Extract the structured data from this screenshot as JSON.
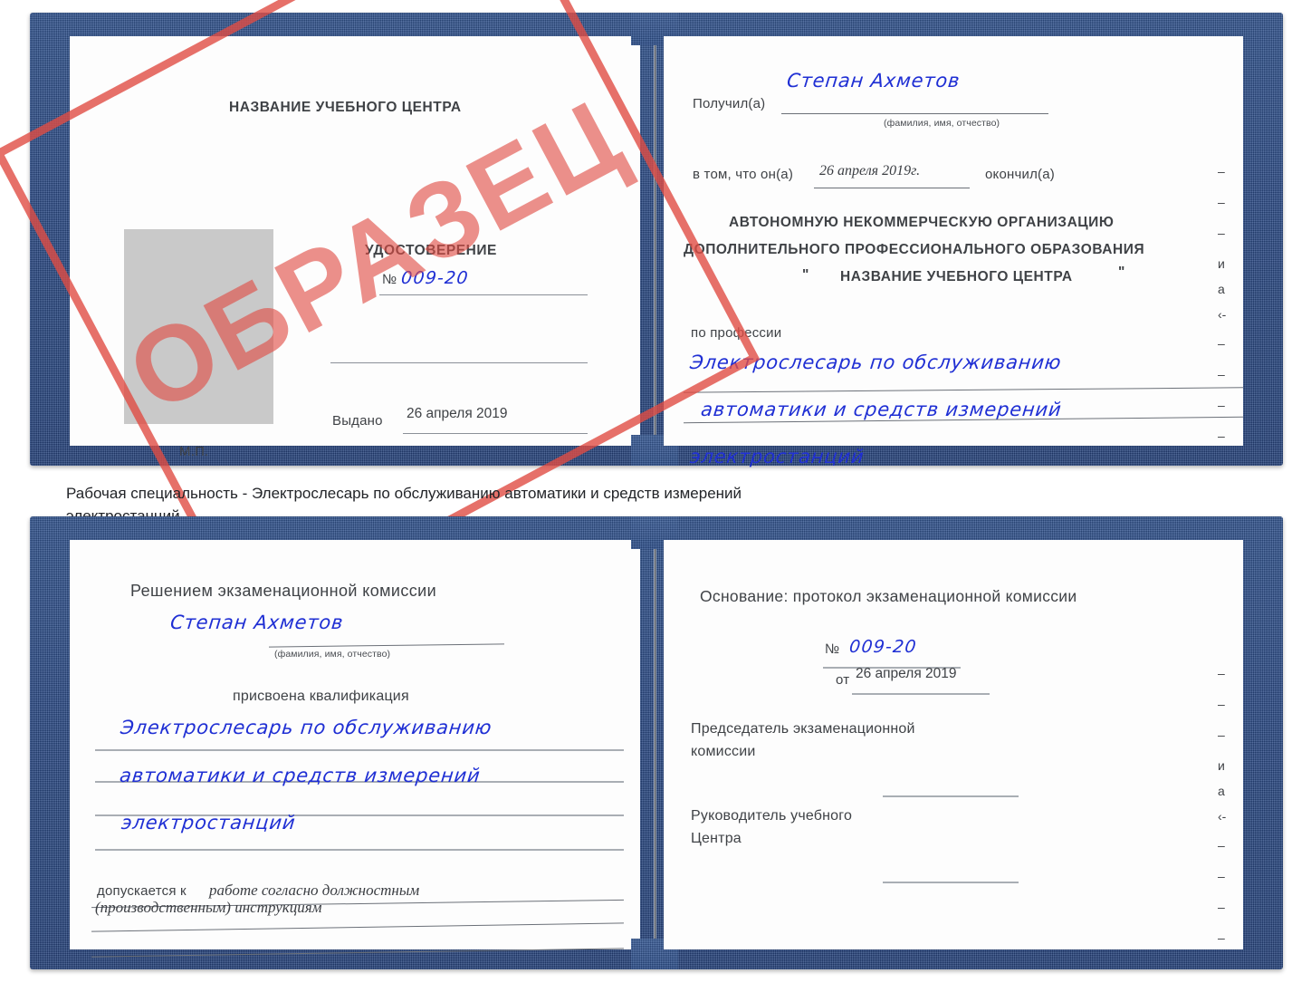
{
  "colors": {
    "cover_blue": "#2b4e8c",
    "ink_blue": "#1f2fd4",
    "stamp_red": "#e04c44",
    "print_gray": "#3f4246",
    "rule_gray": "#8b9098",
    "photo_gray": "#c9c9c9"
  },
  "stamp": {
    "text": "ОБРАЗЕЦ"
  },
  "caption": {
    "line1": "Рабочая специальность - Электрослесарь по обслуживанию автоматики и средств измерений",
    "line2": "электростанций"
  },
  "certificate_front": {
    "left_page": {
      "center_name": "НАЗВАНИЕ УЧЕБНОГО ЦЕНТРА",
      "doc_title": "УДОСТОВЕРЕНИЕ",
      "number_label": "№",
      "number_value": "009-20",
      "issued_label": "Выдано",
      "issued_date": "26 апреля 2019",
      "seal_label": "М.П.",
      "photo_placeholder": ""
    },
    "right_page": {
      "received_label": "Получил(а)",
      "received_name": "Степан Ахметов",
      "fio_hint": "(фамилия, имя, отчество)",
      "in_that_label": "в том, что он(а)",
      "completion_date": "26 апреля 2019г.",
      "finished_label": "окончил(а)",
      "org_line1": "АВТОНОМНУЮ НЕКОММЕРЧЕСКУЮ ОРГАНИЗАЦИЮ",
      "org_line2": "ДОПОЛНИТЕЛЬНОГО ПРОФЕССИОНАЛЬНОГО ОБРАЗОВАНИЯ",
      "org_quote_open": "\"",
      "org_line3": "НАЗВАНИЕ УЧЕБНОГО ЦЕНТРА",
      "org_quote_close": "\"",
      "profession_label": "по профессии",
      "profession_line1": "Электрослесарь по обслуживанию",
      "profession_line2": "автоматики и средств измерений",
      "profession_line3": "электростанций",
      "edge_fragments": [
        "–",
        "–",
        "–",
        "и",
        "а",
        "‹-",
        "–",
        "–",
        "–",
        "–"
      ]
    }
  },
  "certificate_back": {
    "left_page": {
      "decision_title": "Решением экзаменационной комиссии",
      "name": "Степан Ахметов",
      "fio_hint": "(фамилия, имя, отчество)",
      "qualification_label": "присвоена квалификация",
      "qualification_line1": "Электрослесарь по обслуживанию",
      "qualification_line2": "автоматики и средств измерений",
      "qualification_line3": "электростанций",
      "admitted_label": "допускается к",
      "admitted_line1": "работе согласно должностным",
      "admitted_line2": "(производственным) инструкциям"
    },
    "right_page": {
      "basis_label": "Основание: протокол экзаменационной комиссии",
      "number_label": "№",
      "number_value": "009-20",
      "date_label": "от",
      "date_value": "26 апреля 2019",
      "chairman_line1": "Председатель экзаменационной",
      "chairman_line2": "комиссии",
      "head_line1": "Руководитель учебного",
      "head_line2": "Центра",
      "edge_fragments": [
        "–",
        "–",
        "–",
        "и",
        "а",
        "‹-",
        "–",
        "–",
        "–",
        "–"
      ]
    }
  }
}
